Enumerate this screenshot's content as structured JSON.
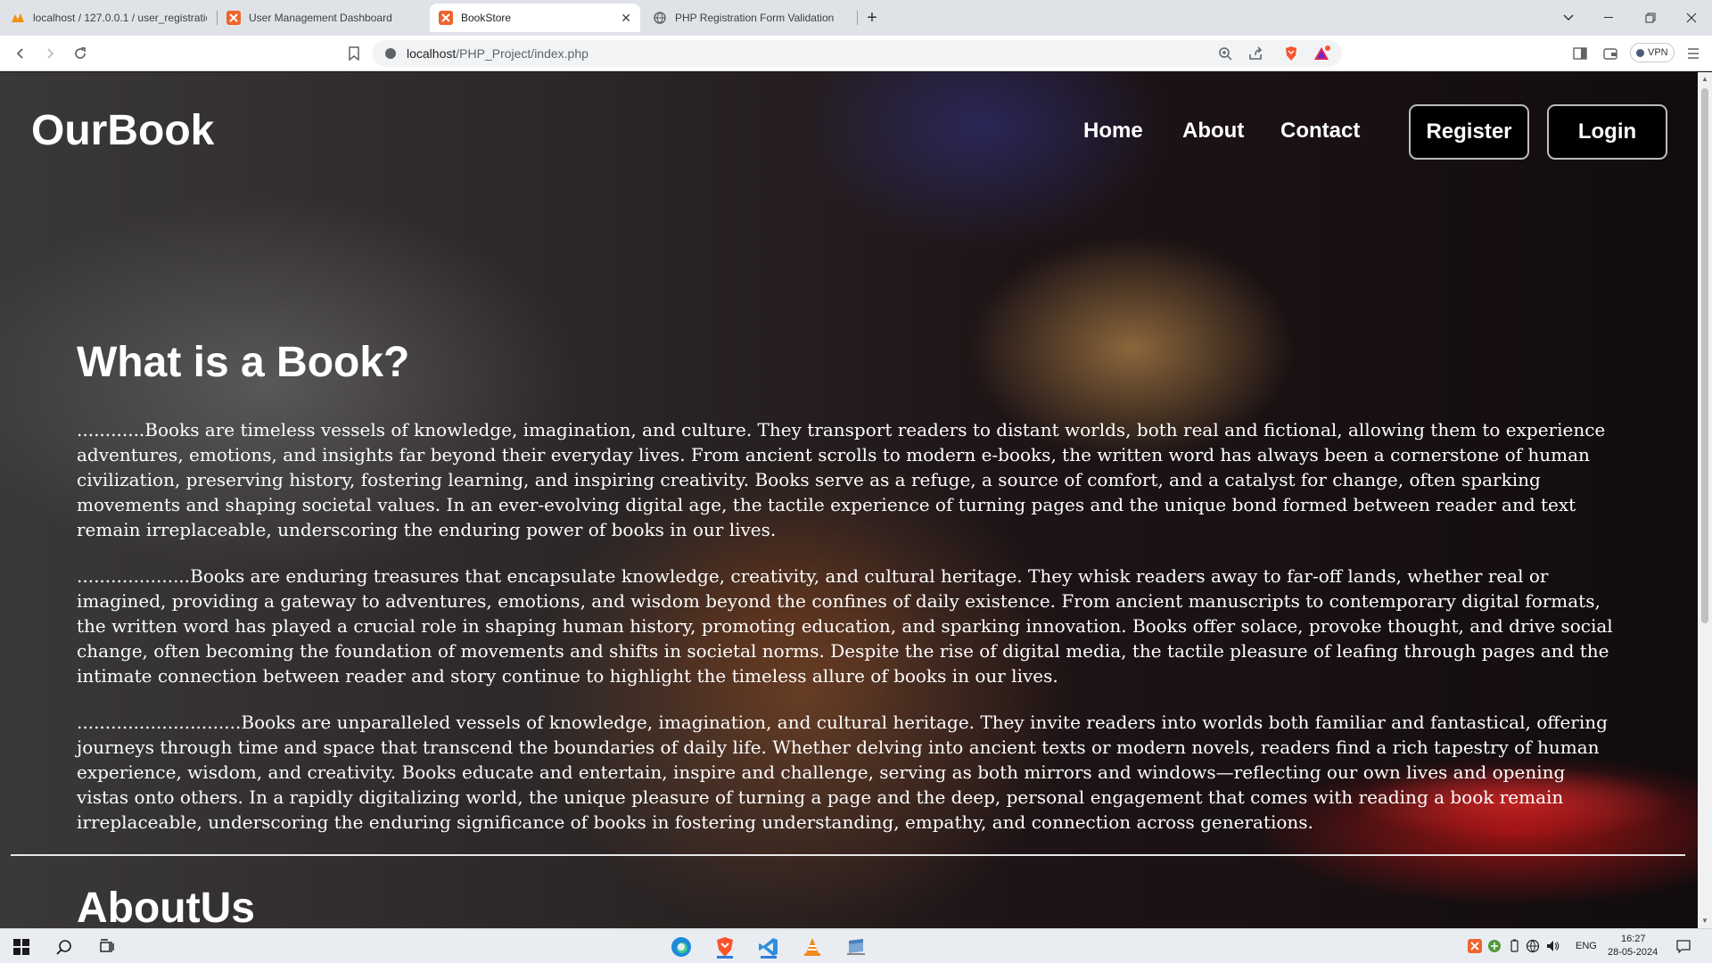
{
  "browser": {
    "tabs": [
      {
        "title": "localhost / 127.0.0.1 / user_registratio",
        "active": false
      },
      {
        "title": "User Management Dashboard",
        "active": false
      },
      {
        "title": "BookStore",
        "active": true
      },
      {
        "title": "PHP Registration Form Validation",
        "active": false
      }
    ],
    "address": {
      "host": "localhost",
      "path": "/PHP_Project/index.php"
    },
    "vpn_label": "VPN"
  },
  "site": {
    "logo": "OurBook",
    "nav": {
      "home": "Home",
      "about": "About",
      "contact": "Contact",
      "register": "Register",
      "login": "Login"
    },
    "section1": {
      "title": "What is a Book?",
      "paragraphs": [
        "............Books are timeless vessels of knowledge, imagination, and culture. They transport readers to distant worlds, both real and fictional, allowing them to experience adventures, emotions, and insights far beyond their everyday lives. From ancient scrolls to modern e-books, the written word has always been a cornerstone of human civilization, preserving history, fostering learning, and inspiring creativity. Books serve as a refuge, a source of comfort, and a catalyst for change, often sparking movements and shaping societal values. In an ever-evolving digital age, the tactile experience of turning pages and the unique bond formed between reader and text remain irreplaceable, underscoring the enduring power of books in our lives.",
        "....................Books are enduring treasures that encapsulate knowledge, creativity, and cultural heritage. They whisk readers away to far-off lands, whether real or imagined, providing a gateway to adventures, emotions, and wisdom beyond the confines of daily existence. From ancient manuscripts to contemporary digital formats, the written word has played a crucial role in shaping human history, promoting education, and sparking innovation. Books offer solace, provoke thought, and drive social change, often becoming the foundation of movements and shifts in societal norms. Despite the rise of digital media, the tactile pleasure of leafing through pages and the intimate connection between reader and story continue to highlight the timeless allure of books in our lives.",
        ".............................Books are unparalleled vessels of knowledge, imagination, and cultural heritage. They invite readers into worlds both familiar and fantastical, offering journeys through time and space that transcend the boundaries of daily life. Whether delving into ancient texts or modern novels, readers find a rich tapestry of human experience, wisdom, and creativity. Books educate and entertain, inspire and challenge, serving as both mirrors and windows—reflecting our own lives and opening vistas onto others. In a rapidly digitalizing world, the unique pleasure of turning a page and the deep, personal engagement that comes with reading a book remain irreplaceable, underscoring the enduring significance of books in fostering understanding, empathy, and connection across generations."
      ]
    },
    "section2": {
      "title": "AboutUs"
    }
  },
  "taskbar": {
    "language": "ENG",
    "time": "16:27",
    "date": "28-05-2024"
  },
  "colors": {
    "accent": "#2f7bd8",
    "brave": "#fb542b",
    "vscode": "#2b8fe0"
  }
}
